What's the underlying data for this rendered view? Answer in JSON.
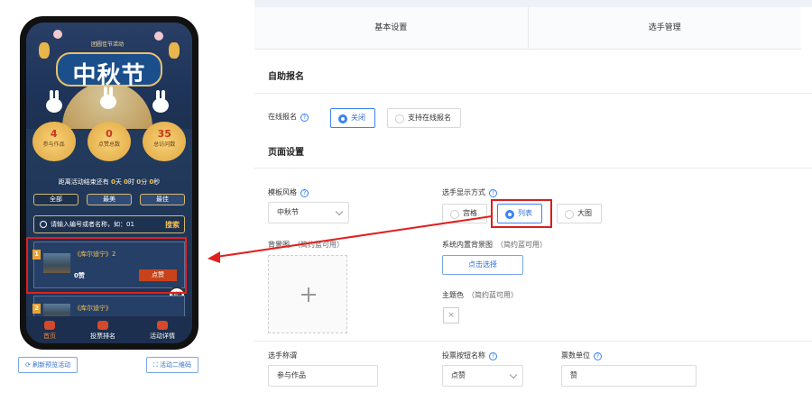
{
  "preview": {
    "banner_subtitle": "团圆佳节活动",
    "festival_title": "中秋节",
    "stats": [
      {
        "value": "4",
        "label": "参与作品"
      },
      {
        "value": "0",
        "label": "点赞总数"
      },
      {
        "value": "35",
        "label": "总访问数"
      }
    ],
    "countdown": {
      "prefix": "距离活动结束还有",
      "days": "0",
      "d": "天",
      "hours": "0",
      "h": "时",
      "minutes": "0",
      "m": "分",
      "seconds": "0",
      "s": "秒"
    },
    "filter_tabs": [
      "全部",
      "最美",
      "最佳"
    ],
    "search": {
      "placeholder": "请输入编号或者名称，如：01",
      "button": "搜索"
    },
    "entries": [
      {
        "rank": "1",
        "name": "《库尔迪宁》2",
        "votes": "0赞",
        "vote_label": "点赞"
      },
      {
        "rank": "2",
        "name": "《库尔迪宁》"
      }
    ],
    "fab_label": "创建",
    "bottom_nav": [
      "首页",
      "投票排名",
      "活动详情"
    ],
    "buttons": {
      "refresh": "刷新预览活动",
      "qrcode": "活动二维码"
    }
  },
  "tabs": [
    "基本设置",
    "选手管理"
  ],
  "sections": {
    "self_signup": "自助报名",
    "page_settings": "页面设置"
  },
  "online_signup": {
    "label": "在线报名",
    "options": [
      "关闭",
      "支持在线报名"
    ],
    "selected": "关闭"
  },
  "template_style": {
    "label": "模板风格",
    "value": "中秋节"
  },
  "display_mode": {
    "label": "选手显示方式",
    "options": [
      "宫格",
      "列表",
      "大图"
    ],
    "selected": "列表"
  },
  "background": {
    "label": "背景图",
    "hint": "（简约蓝可用）"
  },
  "builtin_bg": {
    "label": "系统内置背景图",
    "hint": "（简约蓝可用）",
    "button": "点击选择"
  },
  "theme_color": {
    "label": "主题色",
    "hint": "（简约蓝可用）",
    "swatch": "×"
  },
  "player_title": {
    "label": "选手称谓",
    "value": "参与作品"
  },
  "vote_button_name": {
    "label": "投票按钮名称",
    "value": "点赞"
  },
  "vote_unit": {
    "label": "票数单位",
    "value": "赞"
  },
  "colors": {
    "accent": "#3b82f6",
    "annotation": "#e02020"
  }
}
